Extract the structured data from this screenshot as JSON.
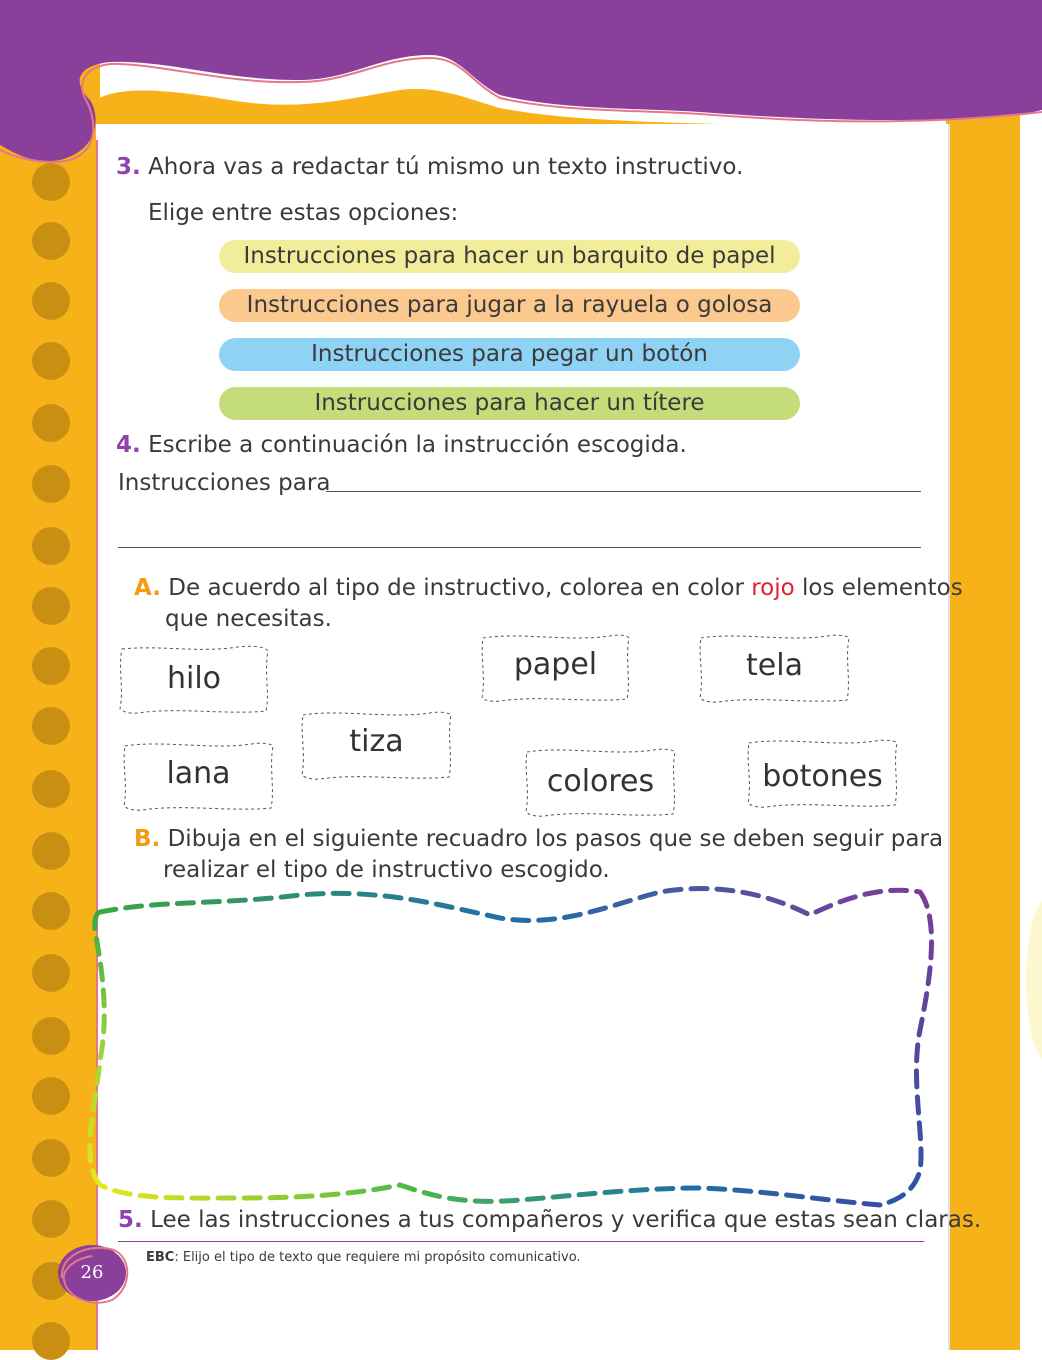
{
  "q3": {
    "number": "3.",
    "text": "Ahora vas a redactar tú mismo un texto instructivo."
  },
  "choose_prompt": "Elige entre estas opciones:",
  "options": [
    {
      "label": "Instrucciones para hacer un barquito de papel",
      "color": "#f2ed9a"
    },
    {
      "label": "Instrucciones para jugar a la rayuela o golosa",
      "color": "#fbc88d"
    },
    {
      "label": "Instrucciones para pegar un botón",
      "color": "#8fd3f4"
    },
    {
      "label": "Instrucciones para hacer un títere",
      "color": "#c5dc7a"
    }
  ],
  "q4": {
    "number": "4.",
    "text": "Escribe a continuación la instrucción escogida."
  },
  "instructions_label": "Instrucciones para",
  "partA": {
    "letter": "A.",
    "text_before": "De acuerdo al tipo de instructivo, colorea en color",
    "highlight": "rojo",
    "text_after": "los elementos",
    "line2": "que necesitas."
  },
  "words": [
    "hilo",
    "papel",
    "tela",
    "tiza",
    "lana",
    "colores",
    "botones"
  ],
  "partB": {
    "letter": "B.",
    "line1": "Dibuja en el siguiente recuadro los pasos que se deben seguir para",
    "line2": "realizar el tipo de instructivo escogido."
  },
  "q5": {
    "number": "5.",
    "text": "Lee las instrucciones a tus compañeros y verifica que estas sean claras."
  },
  "ebc": {
    "label": "EBC",
    "text": ": Elijo el tipo de texto que requiere mi propósito comunicativo."
  },
  "page_number": "26",
  "colors": {
    "purple": "#8a3f9a",
    "yellow": "#f8b219",
    "red_word": "#e0202f"
  }
}
